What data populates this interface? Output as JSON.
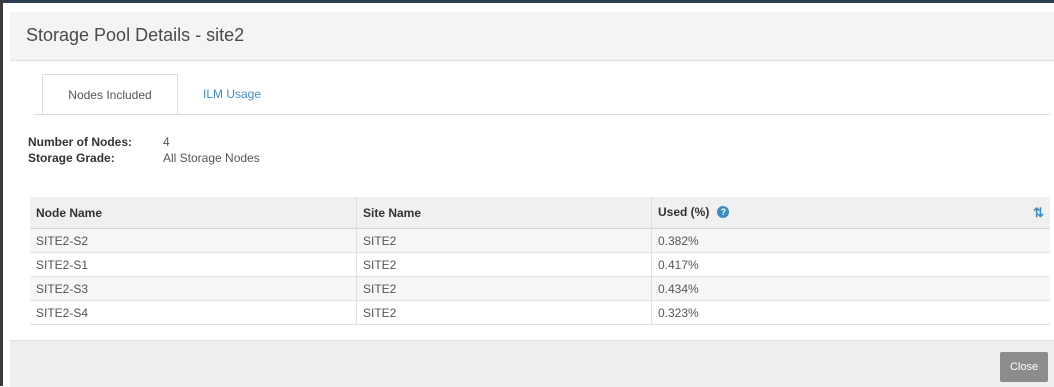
{
  "modal": {
    "title": "Storage Pool Details - site2",
    "tabs": [
      {
        "label": "Nodes Included",
        "active": true
      },
      {
        "label": "ILM Usage",
        "active": false
      }
    ],
    "info": {
      "nodes_label": "Number of Nodes:",
      "nodes_value": "4",
      "grade_label": "Storage Grade:",
      "grade_value": "All Storage Nodes"
    },
    "table": {
      "columns": [
        "Node Name",
        "Site Name",
        "Used (%)"
      ],
      "rows": [
        [
          "SITE2-S2",
          "SITE2",
          "0.382%"
        ],
        [
          "SITE2-S1",
          "SITE2",
          "0.417%"
        ],
        [
          "SITE2-S3",
          "SITE2",
          "0.434%"
        ],
        [
          "SITE2-S4",
          "SITE2",
          "0.323%"
        ]
      ],
      "help_icon": "question-circle-icon",
      "sort_icon": "sort-icon"
    },
    "footer": {
      "close_label": "Close"
    }
  },
  "colors": {
    "accent": "#3c8dbc",
    "header_bg": "#f4f4f4",
    "button_bg": "#8c8c8c"
  }
}
